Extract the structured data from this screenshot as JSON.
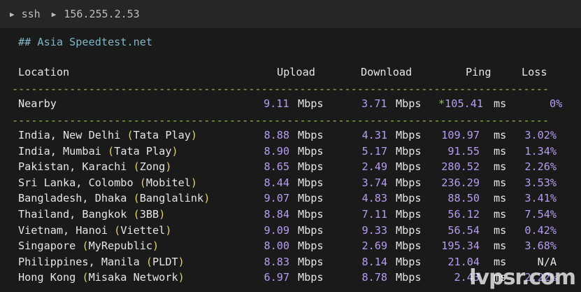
{
  "tab": {
    "label1": "ssh",
    "label2": "156.255.2.53"
  },
  "heading": "## Asia Speedtest.net",
  "headers": {
    "location": "Location",
    "upload": "Upload",
    "download": "Download",
    "ping": "Ping",
    "loss": "Loss"
  },
  "separator": "------------------------------------------------------------------------------------",
  "nearby": {
    "location": "Nearby",
    "upload": "9.11",
    "upload_unit": "Mbps",
    "download": "3.71",
    "download_unit": "Mbps",
    "ping": "*105.41",
    "ping_unit": "ms",
    "loss": "0%"
  },
  "rows": [
    {
      "name": "India, New Delhi ",
      "isp": "Tata Play",
      "upload": "8.88",
      "download": "4.31",
      "ping": "109.97",
      "loss": "3.02%"
    },
    {
      "name": "India, Mumbai ",
      "isp": "Tata Play",
      "upload": "8.90",
      "download": "5.17",
      "ping": "91.55",
      "loss": "1.34%"
    },
    {
      "name": "Pakistan, Karachi ",
      "isp": "Zong",
      "upload": "8.65",
      "download": "2.49",
      "ping": "280.52",
      "loss": "2.26%"
    },
    {
      "name": "Sri Lanka, Colombo ",
      "isp": "Mobitel",
      "upload": "8.44",
      "download": "3.74",
      "ping": "236.29",
      "loss": "3.53%"
    },
    {
      "name": "Bangladesh, Dhaka ",
      "isp": "Banglalink",
      "upload": "9.07",
      "download": "4.83",
      "ping": "88.50",
      "loss": "3.41%"
    },
    {
      "name": "Thailand, Bangkok ",
      "isp": "3BB",
      "upload": "8.84",
      "download": "7.11",
      "ping": "56.12",
      "loss": "7.54%"
    },
    {
      "name": "Vietnam, Hanoi ",
      "isp": "Viettel",
      "upload": "9.09",
      "download": "9.33",
      "ping": "56.54",
      "loss": "0.42%"
    },
    {
      "name": "Singapore ",
      "isp": "MyRepublic",
      "upload": "8.00",
      "download": "2.69",
      "ping": "195.34",
      "loss": "3.68%"
    },
    {
      "name": "Philippines, Manila ",
      "isp": "PLDT",
      "upload": "8.83",
      "download": "8.14",
      "ping": "21.04",
      "loss": "N/A"
    },
    {
      "name": "Hong Kong ",
      "isp": "Misaka Network",
      "upload": "6.97",
      "download": "8.78",
      "ping": "2.43",
      "loss": "2.22%"
    }
  ],
  "units": {
    "mbps": "Mbps",
    "ms": "ms"
  },
  "watermark": "lvpsr.com",
  "colors": {
    "background": "#1a1a1a",
    "tab_bar": "#262626",
    "heading": "#7fb6c8",
    "separator": "#8fbf56",
    "number": "#b79cf0",
    "isp_paren": "#e0d36a"
  }
}
